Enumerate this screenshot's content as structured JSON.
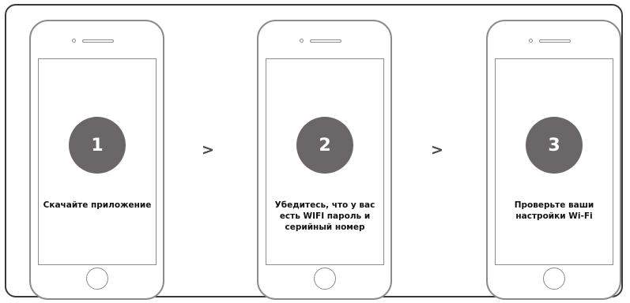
{
  "steps": [
    {
      "number": "1",
      "text": "Скачайте приложение"
    },
    {
      "number": "2",
      "text": "Убедитесь, что у вас\nесть WIFI пароль и\nсерийный номер"
    },
    {
      "number": "3",
      "text": "Проверьте ваши\nнастройки Wi-Fi"
    }
  ],
  "arrows": [
    ">",
    ">"
  ],
  "colors": {
    "circle": "#6b6768",
    "phone_outline": "#8c8c8c",
    "frame_border": "#3a3a3a",
    "text": "#111111"
  },
  "icons": [
    "phone-camera-icon",
    "phone-speaker-icon",
    "phone-home-button-icon"
  ]
}
